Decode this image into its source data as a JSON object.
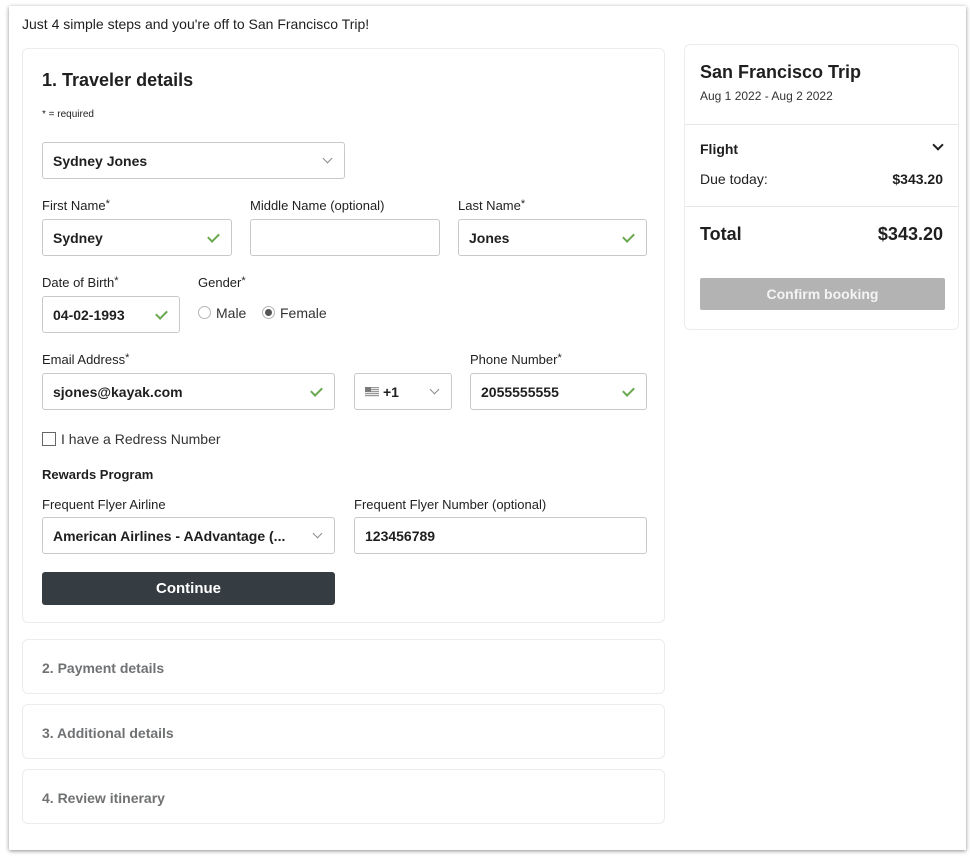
{
  "intro_text": "Just 4 simple steps and you're off to San Francisco Trip!",
  "traveler": {
    "section_title": "1. Traveler details",
    "required_note": "* = required",
    "traveler_select": "Sydney Jones",
    "first_name": {
      "label": "First Name",
      "value": "Sydney"
    },
    "middle_name": {
      "label": "Middle Name (optional)",
      "value": ""
    },
    "last_name": {
      "label": "Last Name",
      "value": "Jones"
    },
    "dob": {
      "label": "Date of Birth",
      "value": "04-02-1993"
    },
    "gender": {
      "label": "Gender",
      "options": [
        "Male",
        "Female"
      ],
      "selected": "Female"
    },
    "email": {
      "label": "Email Address",
      "value": "sjones@kayak.com"
    },
    "country_code": "+1",
    "phone": {
      "label": "Phone Number",
      "value": "2055555555"
    },
    "redress_label": "I have a Redress Number",
    "rewards_heading": "Rewards Program",
    "ff_airline": {
      "label": "Frequent Flyer Airline",
      "value": "American Airlines - AAdvantage (..."
    },
    "ff_number": {
      "label": "Frequent Flyer Number (optional)",
      "value": "123456789"
    },
    "continue_label": "Continue",
    "required_star": "*"
  },
  "steps": [
    "2. Payment details",
    "3. Additional details",
    "4. Review itinerary"
  ],
  "summary": {
    "trip_title": "San Francisco Trip",
    "trip_dates": "Aug 1 2022 - Aug 2 2022",
    "flight_label": "Flight",
    "due_label": "Due today:",
    "due_value": "$343.20",
    "total_label": "Total",
    "total_value": "$343.20",
    "confirm_label": "Confirm booking"
  },
  "colors": {
    "continue_bg": "#363d42",
    "confirm_bg": "#b3b3b3",
    "valid_check": "#6aa84f"
  }
}
